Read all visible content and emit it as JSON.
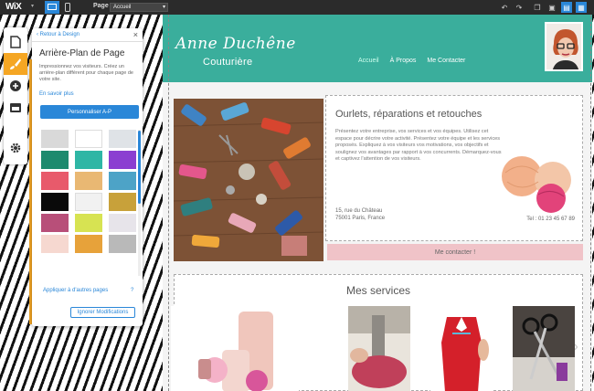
{
  "topbar": {
    "logo": "WiX",
    "page_label": "Page :",
    "page_value": "Accueil"
  },
  "site": {
    "brand_name": "Anne Duchêne",
    "brand_sub": "Couturière",
    "nav": [
      "Accueil",
      "À Propos",
      "Me Contacter"
    ],
    "hero_title": "Ourlets, réparations et retouches",
    "hero_text": "Présentez votre entreprise, vos services et vos équipes. Utilisez cet espace pour décrire votre activité. Présentez votre équipe et les services proposés. Expliquez à vos visiteurs vos motivations, vos objectifs et soulignez vos avantages par rapport à vos concurrents. Démarquez-vous et captivez l'attention de vos visiteurs.",
    "address_line1": "15, rue du Château",
    "address_line2": "75001 Paris, France",
    "phone": "Tel : 01 23 45 67 89",
    "contact_button": "Me contacter !",
    "services_title": "Mes services"
  },
  "panel": {
    "back": "‹ Retour à Design",
    "close": "×",
    "title": "Arrière-Plan de Page",
    "description": "Impressionnez vos visiteurs. Créez un arrière-plan différent pour chaque page de votre site.",
    "learn_more": "En savoir plus",
    "customize_button": "Personnaliser A-P",
    "swatches": [
      "#d9d9d9",
      "#ffffff",
      "#dfe3e7",
      "#1d8a6e",
      "#2fb6a5",
      "#8b3fd1",
      "#e85a6b",
      "#e9b873",
      "#4da3c7",
      "#0a0a0a",
      "#f1f1f1",
      "#c8a13a",
      "#b84f79",
      "#d7e352",
      "#e7e4ea",
      "#f6d8d0",
      "#e7a23a",
      "#b9b9b9"
    ],
    "apply_link": "Appliquer à d'autres pages",
    "help": "?",
    "ignore_button": "Ignorer Modifications"
  }
}
